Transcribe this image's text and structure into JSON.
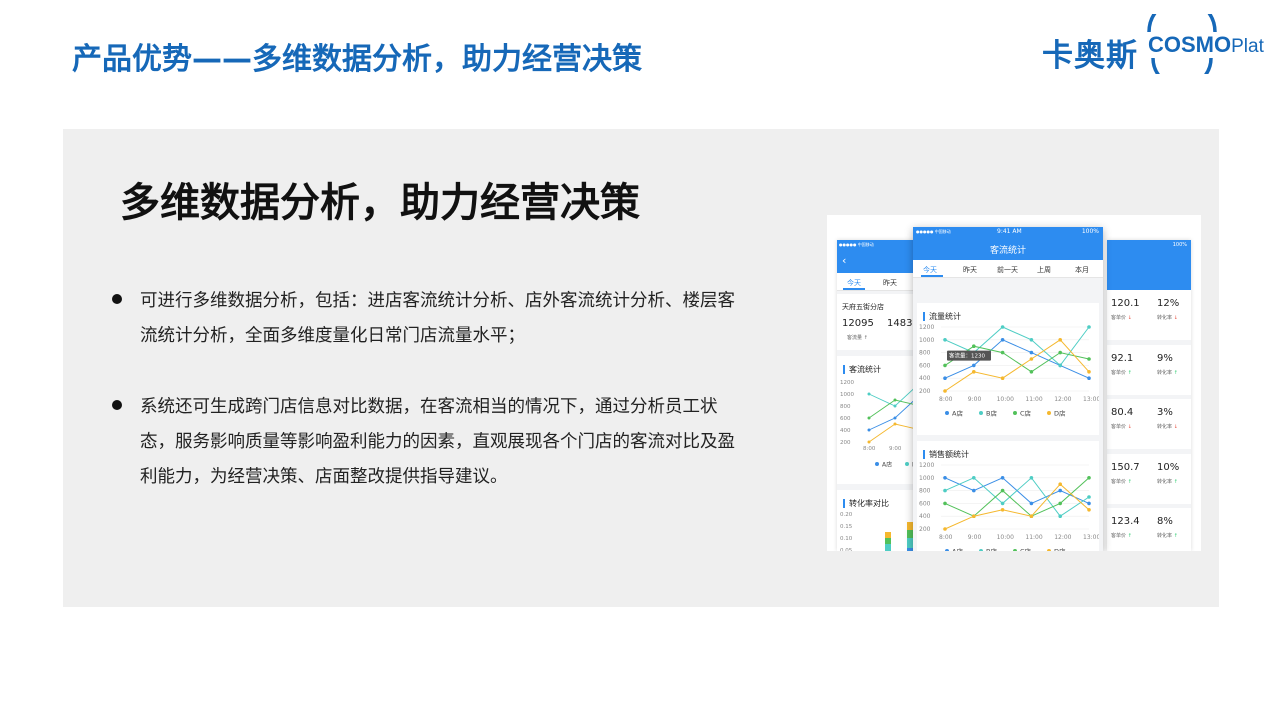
{
  "header": {
    "title": "产品优势——多维数据分析，助力经营决策",
    "brand_cn": "卡奥斯",
    "brand_en": "COSMO",
    "brand_en_suffix": "Plat"
  },
  "main": {
    "heading": "多维数据分析，助力经营决策",
    "bullets": [
      "可进行多维数据分析，包括：进店客流统计分析、店外客流统计分析、楼层客流统计分析，全面多维度量化日常门店流量水平；",
      "系统还可生成跨门店信息对比数据，在客流相当的情况下，通过分析员工状态，服务影响质量等影响盈利能力的因素，直观展现各个门店的客流对比及盈利能力，为经营决策、店面整改提供指导建议。"
    ]
  },
  "phone_main": {
    "status_carrier": "●●●●● 中国移动",
    "status_time": "9:41 AM",
    "status_battery": "100%",
    "nav_title": "客流统计",
    "tabs": [
      "今天",
      "昨天",
      "前一天",
      "上周",
      "本月"
    ],
    "active_tab": 0,
    "chart1_title": "流量统计",
    "chart2_title": "销售额统计",
    "tooltip": "客流量：1230",
    "legend": [
      "A店",
      "B店",
      "C店",
      "D店"
    ],
    "series_colors": [
      "#3a8ee6",
      "#4ecdc4",
      "#52c15a",
      "#f5b82e"
    ]
  },
  "phone_left": {
    "status_carrier": "●●●●● 中国移动",
    "tabs": [
      "今天",
      "昨天"
    ],
    "store_name": "天府五街分店",
    "value1": "12095",
    "value2": "1483.",
    "label1": "客流量 ↑",
    "card2_title": "客流统计",
    "card3_title": "转化率对比",
    "legend": [
      "A店",
      "B店"
    ],
    "y_ticks": [
      "1200",
      "1000",
      "800",
      "600",
      "400",
      "200"
    ],
    "x_ticks": [
      "8:00",
      "9:00"
    ],
    "rate_ticks": [
      "0.20",
      "0.15",
      "0.10",
      "0.05"
    ]
  },
  "phone_right": {
    "status_battery": "100%",
    "rows": [
      {
        "price": "120.1",
        "rate": "12%",
        "rate_dir": "down"
      },
      {
        "price": "92.1",
        "rate": "9%",
        "rate_dir": "up"
      },
      {
        "price": "80.4",
        "rate": "3%",
        "rate_dir": "down"
      },
      {
        "price": "150.7",
        "rate": "10%",
        "rate_dir": "up"
      },
      {
        "price": "123.4",
        "rate": "8%",
        "rate_dir": "up"
      }
    ],
    "price_label": "客单价",
    "rate_label": "转化率"
  },
  "chart_data": [
    {
      "type": "line",
      "title": "流量统计",
      "x": [
        "8:00",
        "9:00",
        "10:00",
        "11:00",
        "12:00",
        "13:00"
      ],
      "ylim": [
        200,
        1200
      ],
      "y_ticks": [
        1200,
        1000,
        800,
        600,
        400,
        200
      ],
      "series": [
        {
          "name": "A店",
          "values": [
            400,
            600,
            1000,
            800,
            600,
            400
          ]
        },
        {
          "name": "B店",
          "values": [
            1000,
            800,
            1200,
            1000,
            600,
            1200
          ]
        },
        {
          "name": "C店",
          "values": [
            600,
            900,
            800,
            500,
            800,
            700
          ]
        },
        {
          "name": "D店",
          "values": [
            200,
            500,
            400,
            700,
            1000,
            500
          ]
        }
      ]
    },
    {
      "type": "line",
      "title": "销售额统计",
      "x": [
        "8:00",
        "9:00",
        "10:00",
        "11:00",
        "12:00",
        "13:00"
      ],
      "ylim": [
        200,
        1200
      ],
      "y_ticks": [
        1200,
        1000,
        800,
        600,
        400,
        200
      ],
      "series": [
        {
          "name": "A店",
          "values": [
            1000,
            800,
            1000,
            600,
            800,
            600
          ]
        },
        {
          "name": "B店",
          "values": [
            800,
            1000,
            600,
            1000,
            400,
            700
          ]
        },
        {
          "name": "C店",
          "values": [
            600,
            400,
            800,
            400,
            600,
            1000
          ]
        },
        {
          "name": "D店",
          "values": [
            200,
            400,
            500,
            400,
            900,
            500
          ]
        }
      ]
    }
  ]
}
